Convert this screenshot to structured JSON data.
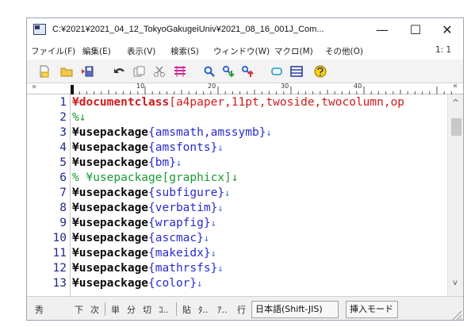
{
  "window": {
    "title": "C:¥2021¥2021_04_12_TokyoGakugeiUniv¥2021_08_16_001J_Com...",
    "min_glyph": "—",
    "max_glyph": "☐",
    "close_glyph": "✕"
  },
  "menu": {
    "items": [
      "ファイル(F)",
      "編集(E)",
      "表示(V)",
      "検索(S)",
      "ウィンドウ(W)",
      "マクロ(M)",
      "その他(O)"
    ],
    "ratio": "1: 1"
  },
  "toolbar": {
    "icons": [
      "new-file-icon",
      "open-folder-icon",
      "save-icon",
      "undo-icon",
      "copy-icon",
      "cut-icon",
      "paste-icon",
      "search-icon",
      "search-next-icon",
      "search-prev-icon",
      "bracket-icon",
      "split-window-icon",
      "help-icon"
    ]
  },
  "ruler": {
    "marks": [
      "10",
      "20",
      "30",
      "40"
    ],
    "left_marker": "»",
    "right_marker": "«"
  },
  "editor": {
    "lines": [
      {
        "num": "1",
        "kw": "¥documentclass",
        "arg": "[a4paper,11pt,twoside,twocolumn,op",
        "rest": ""
      },
      {
        "num": "2",
        "kw": "",
        "arg": "",
        "comment": "%↓"
      },
      {
        "num": "3",
        "kw": "¥usepackage",
        "arg": "{amsmath,amssymb}",
        "rest": "↓"
      },
      {
        "num": "4",
        "kw": "¥usepackage",
        "arg": "{amsfonts}",
        "rest": "↓"
      },
      {
        "num": "5",
        "kw": "¥usepackage",
        "arg": "{bm}",
        "rest": "↓"
      },
      {
        "num": "6",
        "kw": "",
        "arg": "",
        "comment": "% ¥usepackage[graphicx]↓"
      },
      {
        "num": "7",
        "kw": "¥usepackage",
        "arg": "{subfigure}",
        "rest": "↓"
      },
      {
        "num": "8",
        "kw": "¥usepackage",
        "arg": "{verbatim}",
        "rest": "↓"
      },
      {
        "num": "9",
        "kw": "¥usepackage",
        "arg": "{wrapfig}",
        "rest": "↓"
      },
      {
        "num": "10",
        "kw": "¥usepackage",
        "arg": "{ascmac}",
        "rest": "↓"
      },
      {
        "num": "11",
        "kw": "¥usepackage",
        "arg": "{makeidx}",
        "rest": "↓"
      },
      {
        "num": "12",
        "kw": "¥usepackage",
        "arg": "{mathrsfs}",
        "rest": "↓"
      },
      {
        "num": "13",
        "kw": "¥usepackage",
        "arg": "{color}",
        "rest": "↓"
      }
    ]
  },
  "scrollbar": {
    "up": "^",
    "down": "v"
  },
  "status": {
    "items": [
      "秀",
      "下",
      "次",
      "単",
      "分",
      "切",
      "ｺ..",
      "貼",
      "ﾀ..",
      "ｱ..",
      "行"
    ],
    "encoding": "日本語(Shift-JIS)",
    "mode": "挿入モード"
  }
}
